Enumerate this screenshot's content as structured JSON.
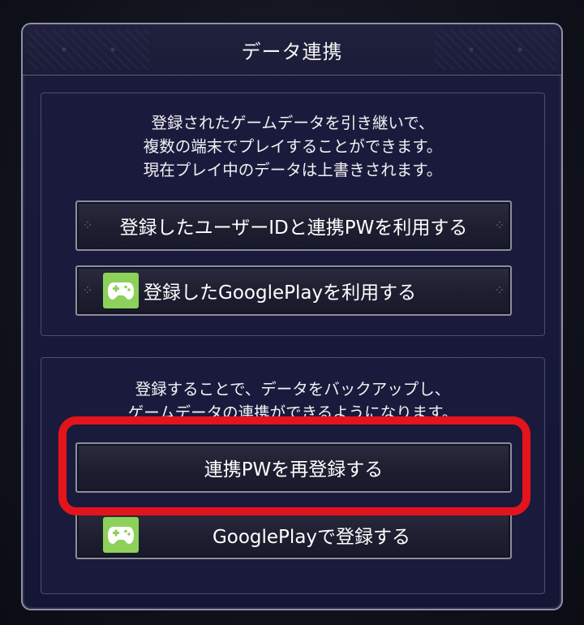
{
  "dialog": {
    "title": "データ連携"
  },
  "transfer_panel": {
    "description_lines": [
      "登録されたゲームデータを引き継いで、",
      "複数の端末でプレイすることができます。",
      "現在プレイ中のデータは上書きされます。"
    ],
    "use_id_pw_label": "登録したユーザーIDと連携PWを利用する",
    "use_googleplay_label": "登録したGooglePlayを利用する"
  },
  "register_panel": {
    "description_lines": [
      "登録することで、データをバックアップし、",
      "ゲームデータの連携ができるようになります。"
    ],
    "reregister_pw_label": "連携PWを再登録する",
    "register_googleplay_label": "GooglePlayで登録する"
  },
  "icons": {
    "googleplay_games": "gamepad-icon",
    "button_ornament": "ornament-icon"
  },
  "colors": {
    "highlight": "#e4141c",
    "googleplay_icon_bg": "#8dd15a"
  }
}
